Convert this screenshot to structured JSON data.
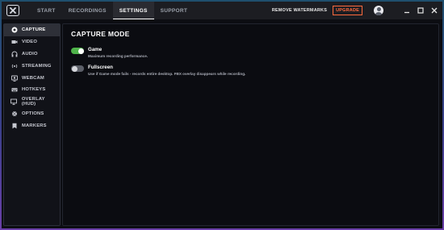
{
  "topbar": {
    "nav": [
      {
        "label": "START",
        "active": false
      },
      {
        "label": "RECORDINGS",
        "active": false
      },
      {
        "label": "SETTINGS",
        "active": true
      },
      {
        "label": "SUPPORT",
        "active": false
      }
    ],
    "remove_watermarks": "REMOVE WATERMARKS",
    "upgrade": "UPGRADE",
    "accent_color": "#ff6a3d"
  },
  "sidebar": {
    "items": [
      {
        "label": "CAPTURE",
        "icon": "record-icon",
        "active": true
      },
      {
        "label": "VIDEO",
        "icon": "video-camera-icon",
        "active": false
      },
      {
        "label": "AUDIO",
        "icon": "headphones-icon",
        "active": false
      },
      {
        "label": "STREAMING",
        "icon": "broadcast-icon",
        "active": false
      },
      {
        "label": "WEBCAM",
        "icon": "webcam-icon",
        "active": false
      },
      {
        "label": "HOTKEYS",
        "icon": "keyboard-icon",
        "active": false
      },
      {
        "label": "OVERLAY (HUD)",
        "icon": "monitor-icon",
        "active": false
      },
      {
        "label": "OPTIONS",
        "icon": "gear-icon",
        "active": false
      },
      {
        "label": "MARKERS",
        "icon": "bookmark-icon",
        "active": false
      }
    ]
  },
  "main": {
    "title": "CAPTURE MODE",
    "options": [
      {
        "label": "Game",
        "description": "Maximum recording performance.",
        "enabled": true
      },
      {
        "label": "Fullscreen",
        "description": "Use if Game mode fails - records entire desktop. FBX overlay disappears while recording.",
        "enabled": false
      }
    ],
    "toggle_on_color": "#4fb34a"
  }
}
